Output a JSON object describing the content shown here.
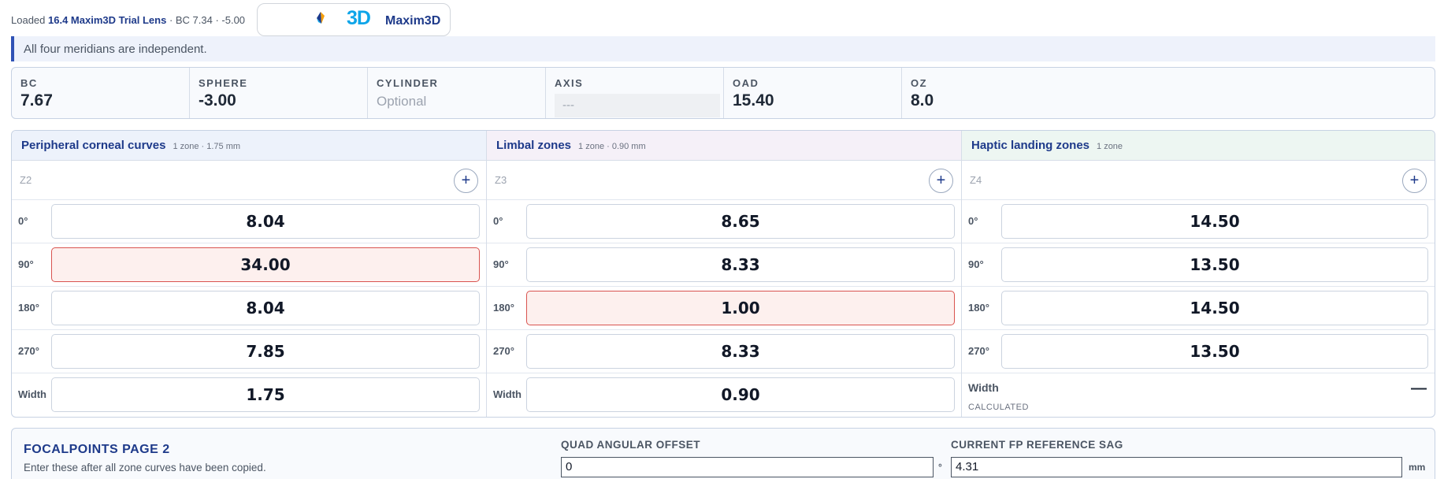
{
  "header": {
    "loaded_prefix": "Loaded",
    "lens_name": "16.4 Maxim3D Trial Lens",
    "lens_detail": "· BC 7.34 · -5.00",
    "logo_3d": "3D",
    "logo_name": "Maxim3D",
    "logo_icon": "maxim3d-logo-icon"
  },
  "banner": {
    "text": "All four meridians are independent."
  },
  "params": {
    "bc": {
      "label": "BC",
      "value": "7.67"
    },
    "sphere": {
      "label": "SPHERE",
      "value": "-3.00"
    },
    "cylinder": {
      "label": "CYLINDER",
      "placeholder": "Optional"
    },
    "axis": {
      "label": "AXIS",
      "placeholder": "---"
    },
    "oad": {
      "label": "OAD",
      "value": "15.40"
    },
    "oz": {
      "label": "OZ",
      "value": "8.0"
    }
  },
  "zones": [
    {
      "title": "Peripheral corneal curves",
      "subtitle": "1 zone · 1.75 mm",
      "zone_id": "Z2",
      "add_label": "+",
      "rows": [
        {
          "label": "0°",
          "value": "8.04",
          "warn": false
        },
        {
          "label": "90°",
          "value": "34.00",
          "warn": true
        },
        {
          "label": "180°",
          "value": "8.04",
          "warn": false
        },
        {
          "label": "270°",
          "value": "7.85",
          "warn": false
        }
      ],
      "width": {
        "label": "Width",
        "value": "1.75"
      }
    },
    {
      "title": "Limbal zones",
      "subtitle": "1 zone · 0.90 mm",
      "zone_id": "Z3",
      "add_label": "+",
      "rows": [
        {
          "label": "0°",
          "value": "8.65",
          "warn": false
        },
        {
          "label": "90°",
          "value": "8.33",
          "warn": false
        },
        {
          "label": "180°",
          "value": "1.00",
          "warn": true
        },
        {
          "label": "270°",
          "value": "8.33",
          "warn": false
        }
      ],
      "width": {
        "label": "Width",
        "value": "0.90"
      }
    },
    {
      "title": "Haptic landing zones",
      "subtitle": "1 zone",
      "zone_id": "Z4",
      "add_label": "+",
      "rows": [
        {
          "label": "0°",
          "value": "14.50",
          "warn": false
        },
        {
          "label": "90°",
          "value": "13.50",
          "warn": false
        },
        {
          "label": "180°",
          "value": "14.50",
          "warn": false
        },
        {
          "label": "270°",
          "value": "13.50",
          "warn": false
        }
      ],
      "width": {
        "label": "Width",
        "tag": "CALCULATED",
        "value": "—"
      }
    }
  ],
  "focalpoints": {
    "title": "FOCALPOINTS PAGE 2",
    "description": "Enter these after all zone curves have been copied.",
    "quad_offset": {
      "label": "QUAD ANGULAR OFFSET",
      "value": "0",
      "unit": "°"
    },
    "ref_sag": {
      "label": "CURRENT FP REFERENCE SAG",
      "value": "4.31",
      "unit": "mm"
    }
  },
  "colors": {
    "accent": "#1e3a8a",
    "logo_blue": "#0ea5e9",
    "warn_border": "#d9534f",
    "warn_bg": "#fdf0ee",
    "banner_bar": "#2f52b5"
  }
}
